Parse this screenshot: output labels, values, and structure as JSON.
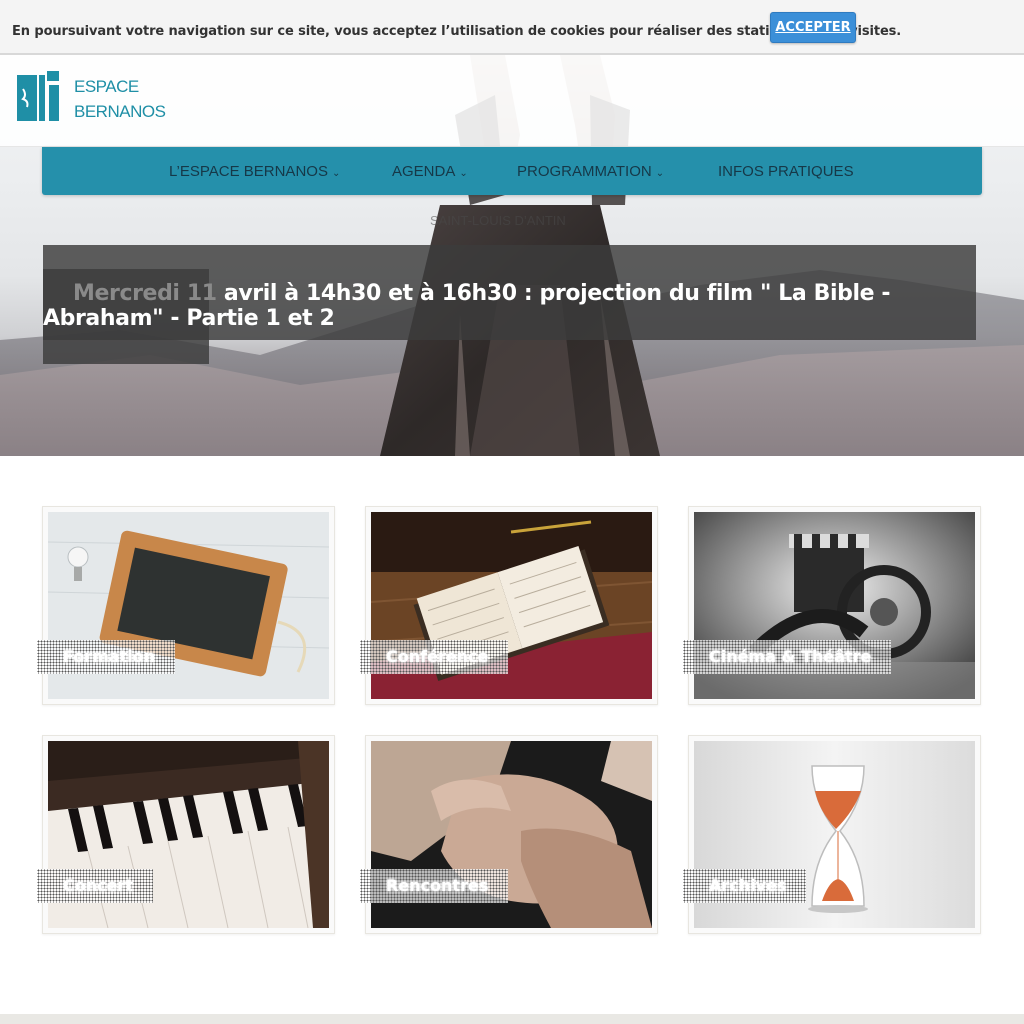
{
  "cookie": {
    "message": "En poursuivant votre navigation sur ce site, vous acceptez l’utilisation de cookies pour réaliser des statistiques de visites.",
    "accept_label": "ACCEPTER"
  },
  "logo": {
    "line1": "ESPACE",
    "line2": "BERNANOS"
  },
  "nav": {
    "items": [
      {
        "label": "L’ESPACE BERNANOS",
        "has_dropdown": true
      },
      {
        "label": "AGENDA",
        "has_dropdown": true
      },
      {
        "label": "PROGRAMMATION",
        "has_dropdown": true
      },
      {
        "label": "INFOS PRATIQUES",
        "has_dropdown": false
      }
    ],
    "dropdown_icon": "chevron-down-icon"
  },
  "hero": {
    "subtitle": "SAINT-LOUIS D’ANTIN",
    "caption_muted": "Mercredi 11",
    "caption_main": "avril à 14h30 et à 16h30 : projection du film \" La Bible - Abraham\" - Partie 1 et 2"
  },
  "cards": [
    {
      "label": "Formation"
    },
    {
      "label": "Conférence"
    },
    {
      "label": "Cinéma & Théâtre"
    },
    {
      "label": "Concert"
    },
    {
      "label": "Rencontres"
    },
    {
      "label": "Archives"
    }
  ],
  "colors": {
    "accent": "#2590ab",
    "logo": "#1f8fa6",
    "button": "#3b8fd8"
  }
}
